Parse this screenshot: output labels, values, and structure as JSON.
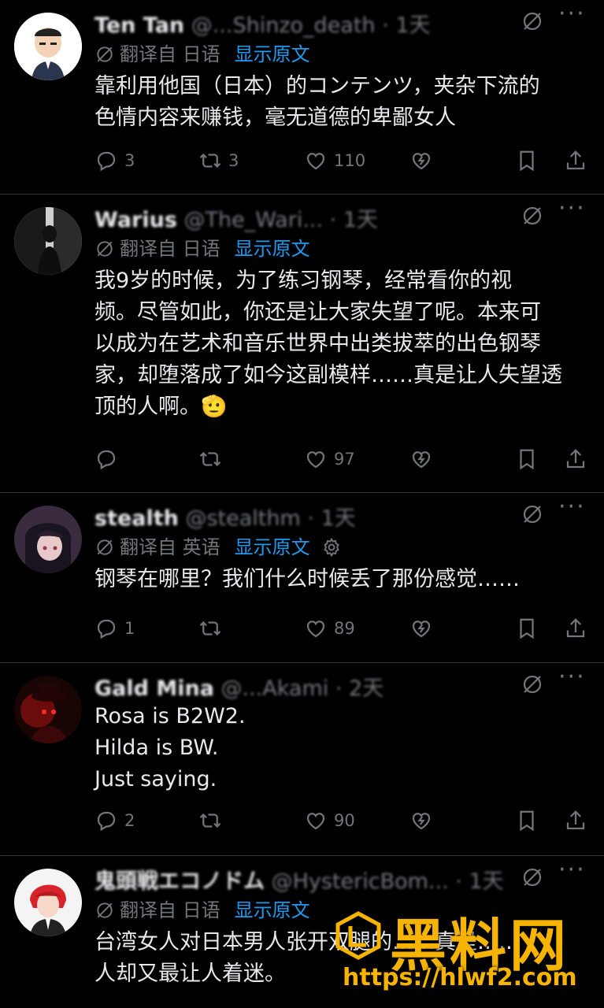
{
  "posts": [
    {
      "display_name": "Ten Tan",
      "handle": "@...Shinzo_death",
      "time": "1天",
      "translate_label": "翻译自 日语",
      "show_original": "显示原文",
      "text": "靠利用他国（日本）的コンテンツ，夹杂下流的\n色情内容来赚钱，毫无道德的卑鄙女人",
      "replies": "3",
      "retweets": "3",
      "likes": "110"
    },
    {
      "display_name": "Warius",
      "handle": "@The_Wari...",
      "time": "1天",
      "translate_label": "翻译自 日语",
      "show_original": "显示原文",
      "text": "我9岁的时候，为了练习钢琴，经常看你的视\n频。尽管如此，你还是让大家失望了呢。本来可\n以成为在艺术和音乐世界中出类拔萃的出色钢琴\n家，却堕落成了如今这副模样……真是让人失望透\n顶的人啊。🫡",
      "replies": "",
      "retweets": "",
      "likes": "97"
    },
    {
      "display_name": "stealth",
      "handle": "@stealthm",
      "time": "1天",
      "translate_label": "翻译自 英语",
      "show_original": "显示原文",
      "text": "钢琴在哪里？我们什么时候丢了那份感觉……",
      "replies": "1",
      "retweets": "",
      "likes": "89"
    },
    {
      "display_name": "Gald Mina",
      "handle": "@...Akami",
      "time": "2天",
      "translate_label": "",
      "show_original": "",
      "text": "Rosa is B2W2.\nHilda is BW.\nJust saying.",
      "replies": "2",
      "retweets": "",
      "likes": "90"
    },
    {
      "display_name": "鬼頭戦エコノドム",
      "handle": "@HystericBom...",
      "time": "1天",
      "translate_label": "翻译自 日语",
      "show_original": "显示原文",
      "text": "台湾女人对日本男人张开双腿的……真是……\n人却又最让人着迷。",
      "replies": "",
      "retweets": "",
      "likes": ""
    }
  ],
  "watermark": {
    "title": "黑料网",
    "url": "https://hlwf2.com"
  },
  "colors": {
    "background": "#000000",
    "text": "#e7e9ea",
    "muted": "#71767b",
    "link": "#1d9bf0",
    "watermark": "#f6b400"
  }
}
